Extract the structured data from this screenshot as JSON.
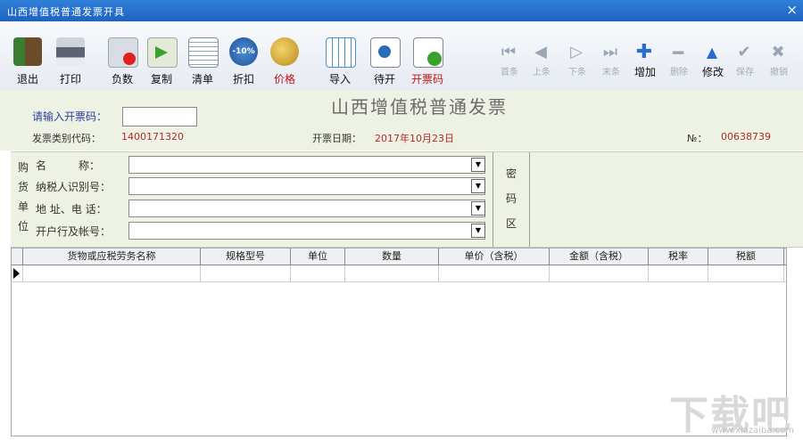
{
  "window": {
    "title": "山西增值税普通发票开具",
    "close_glyph": "×"
  },
  "toolbar": {
    "exit": "退出",
    "print": "打印",
    "negative": "负数",
    "copy": "复制",
    "list": "清单",
    "discount": "折扣",
    "price": "价格",
    "import": "导入",
    "pending": "待开",
    "code_invoice": "开票码",
    "first": "首条",
    "prev": "上条",
    "next": "下条",
    "last": "末条",
    "add": "增加",
    "delete": "删除",
    "modify": "修改",
    "save": "保存",
    "cancel": "撤销",
    "discount_badge": "-10%"
  },
  "header": {
    "invoice_title": "山西增值税普通发票",
    "code_prompt": "请输入开票码：",
    "category_label": "发票类别代码：",
    "category_value": "1400171320",
    "date_label": "开票日期：",
    "date_value": "2017年10月23日",
    "no_label": "№：",
    "no_value": "00638739"
  },
  "buyer": {
    "section_label": [
      "购",
      "货",
      "单",
      "位"
    ],
    "fields": [
      "名　　　称：",
      "纳税人识别号：",
      "地 址、电 话：",
      "开户行及帐号："
    ],
    "dropdown_glyph": "▼",
    "cipher_label": [
      "密",
      "码",
      "区"
    ]
  },
  "grid": {
    "columns": [
      "货物或应税劳务名称",
      "规格型号",
      "单位",
      "数量",
      "单价（含税）",
      "金额（含税）",
      "税率",
      "税额"
    ]
  },
  "watermark": {
    "main": "下载吧",
    "sub": "www.xiazaiba.com"
  },
  "colors": {
    "title_bar": "#1e63c0",
    "form_bg": "#eef2e4",
    "label_blue": "#2b3fa0",
    "value_red": "#b02a2a"
  }
}
